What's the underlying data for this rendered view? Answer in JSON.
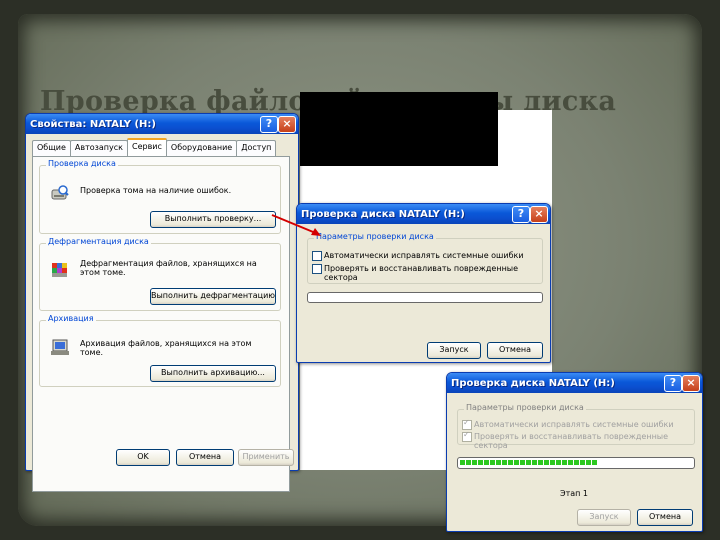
{
  "slide": {
    "title": "Проверка файловой системы диска"
  },
  "props_window": {
    "title": "Свойства: NATALY (H:)",
    "help_btn": "?",
    "close_btn": "×",
    "tabs": [
      "Общие",
      "Автозапуск",
      "Сервис",
      "Оборудование",
      "Доступ"
    ],
    "check_group": {
      "legend": "Проверка диска",
      "text": "Проверка тома на наличие ошибок.",
      "button": "Выполнить проверку..."
    },
    "defrag_group": {
      "legend": "Дефрагментация диска",
      "text": "Дефрагментация файлов, хранящихся на этом томе.",
      "button": "Выполнить дефрагментацию..."
    },
    "archive_group": {
      "legend": "Архивация",
      "text": "Архивация файлов, хранящихся на этом томе.",
      "button": "Выполнить архивацию..."
    },
    "ok": "OK",
    "cancel": "Отмена",
    "apply": "Применить"
  },
  "check_dialog_1": {
    "title": "Проверка диска NATALY (H:)",
    "help_btn": "?",
    "close_btn": "×",
    "params_legend": "Параметры проверки диска",
    "opt1": "Автоматически исправлять системные ошибки",
    "opt2": "Проверять и восстанавливать поврежденные сектора",
    "start": "Запуск",
    "cancel": "Отмена"
  },
  "check_dialog_2": {
    "title": "Проверка диска NATALY (H:)",
    "help_btn": "?",
    "close_btn": "×",
    "params_legend": "Параметры проверки диска",
    "opt1": "Автоматически исправлять системные ошибки",
    "opt2": "Проверять и восстанавливать поврежденные сектора",
    "progress": 0.6,
    "status": "Этап 1",
    "start": "Запуск",
    "cancel": "Отмена"
  },
  "colors": {
    "xp_title_blue": "#0a58d8",
    "legend_blue": "#0046d5",
    "progress_green": "#2cc81f",
    "arrow_red": "#d40000"
  }
}
